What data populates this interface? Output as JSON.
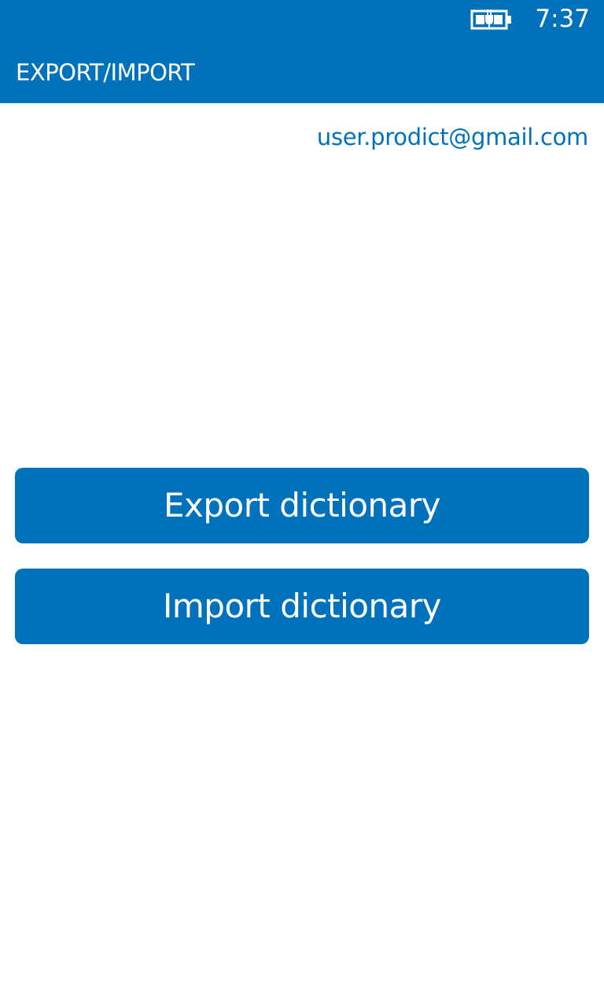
{
  "status_bar": {
    "time": "7:37",
    "battery_icon": "battery-charging-icon"
  },
  "header": {
    "title": "EXPORT/IMPORT",
    "background_color": "#0072bc"
  },
  "account": {
    "email": "user.prodict@gmail.com"
  },
  "actions": {
    "export_label": "Export dictionary",
    "import_label": "Import dictionary"
  },
  "colors": {
    "accent": "#0072bc",
    "text_on_accent": "#ffffff",
    "background": "#ffffff"
  }
}
